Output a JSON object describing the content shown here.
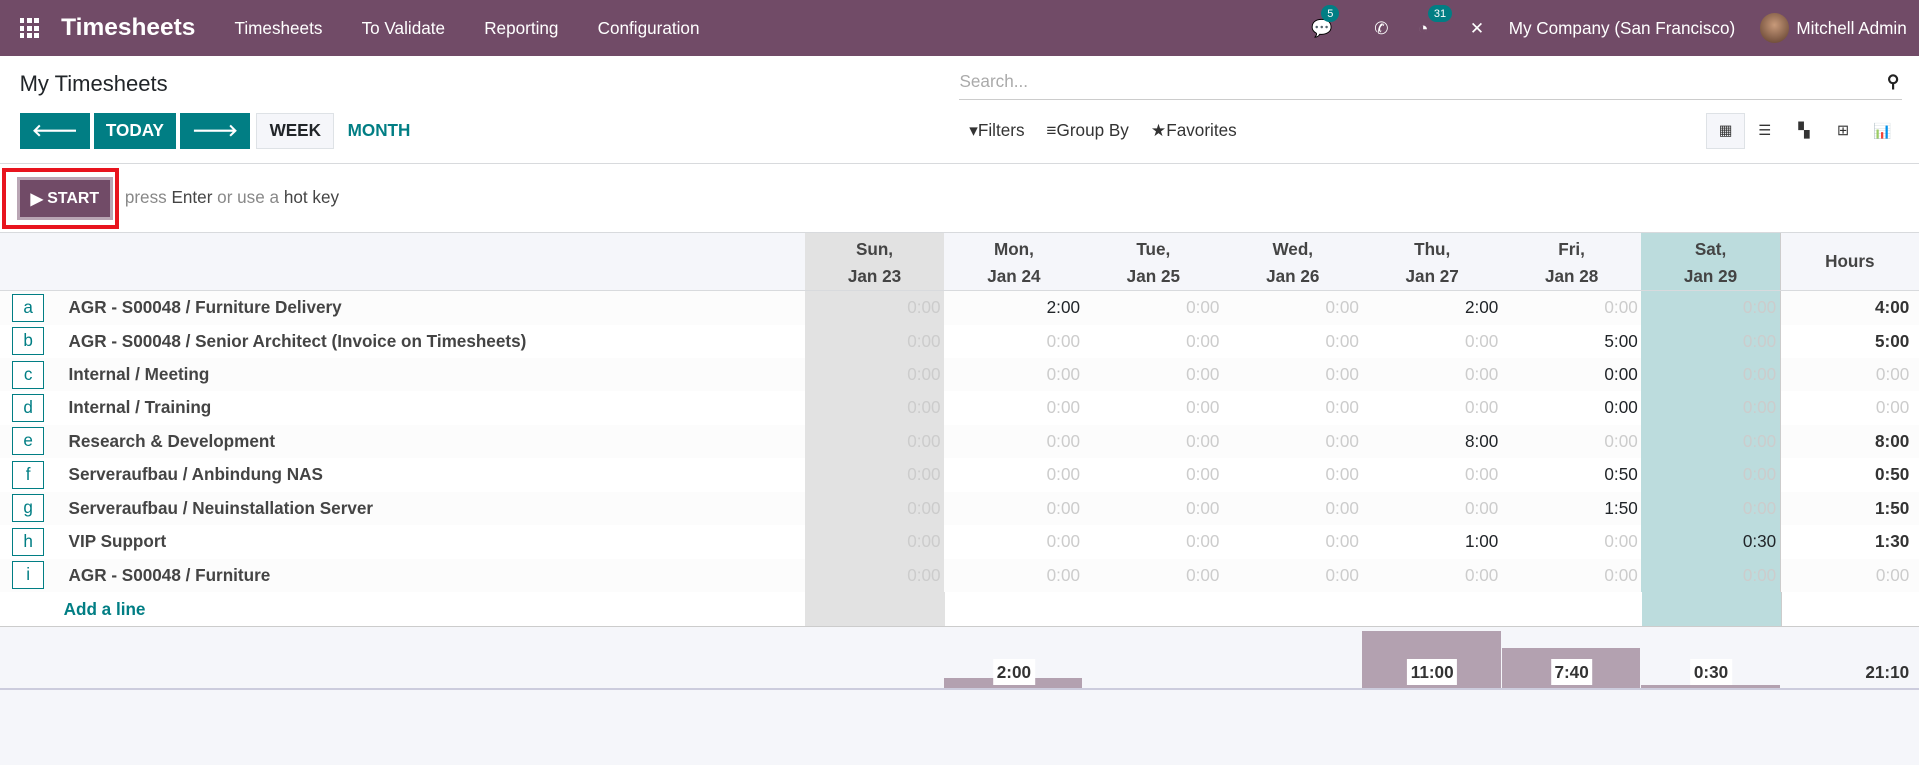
{
  "colors": {
    "brand": "#714B67",
    "accent": "#017e84",
    "highlight": "#e8141e"
  },
  "navbar": {
    "app_title": "Timesheets",
    "menu": [
      "Timesheets",
      "To Validate",
      "Reporting",
      "Configuration"
    ],
    "messages_count": "5",
    "activities_count": "31",
    "company": "My Company (San Francisco)",
    "user": "Mitchell Admin"
  },
  "control": {
    "title": "My Timesheets",
    "today": "TODAY",
    "week": "WEEK",
    "month": "MONTH",
    "search_placeholder": "Search...",
    "filters": "Filters",
    "group_by": "Group By",
    "favorites": "Favorites"
  },
  "start": {
    "label": "START",
    "hint_pre": "press ",
    "hint_key1": "Enter",
    "hint_mid": " or use a ",
    "hint_key2": "hot key"
  },
  "grid": {
    "days": [
      {
        "d": "Sun,",
        "date": "Jan 23"
      },
      {
        "d": "Mon,",
        "date": "Jan 24"
      },
      {
        "d": "Tue,",
        "date": "Jan 25"
      },
      {
        "d": "Wed,",
        "date": "Jan 26"
      },
      {
        "d": "Thu,",
        "date": "Jan 27"
      },
      {
        "d": "Fri,",
        "date": "Jan 28"
      },
      {
        "d": "Sat,",
        "date": "Jan 29"
      }
    ],
    "hours_header": "Hours",
    "rows": [
      {
        "key": "a",
        "label": "AGR - S00048  /  Furniture Delivery",
        "cells": [
          "0:00",
          "2:00",
          "0:00",
          "0:00",
          "2:00",
          "0:00",
          "0:00"
        ],
        "filled": [
          false,
          true,
          false,
          false,
          true,
          false,
          false
        ],
        "total": "4:00"
      },
      {
        "key": "b",
        "label": "AGR - S00048  /  Senior Architect (Invoice on Timesheets)",
        "cells": [
          "0:00",
          "0:00",
          "0:00",
          "0:00",
          "0:00",
          "5:00",
          "0:00"
        ],
        "filled": [
          false,
          false,
          false,
          false,
          false,
          true,
          false
        ],
        "total": "5:00"
      },
      {
        "key": "c",
        "label": "Internal  /  Meeting",
        "cells": [
          "0:00",
          "0:00",
          "0:00",
          "0:00",
          "0:00",
          "0:00",
          "0:00"
        ],
        "filled": [
          false,
          false,
          false,
          false,
          false,
          true,
          false
        ],
        "total": "0:00"
      },
      {
        "key": "d",
        "label": "Internal  /  Training",
        "cells": [
          "0:00",
          "0:00",
          "0:00",
          "0:00",
          "0:00",
          "0:00",
          "0:00"
        ],
        "filled": [
          false,
          false,
          false,
          false,
          false,
          true,
          false
        ],
        "total": "0:00"
      },
      {
        "key": "e",
        "label": "Research & Development",
        "cells": [
          "0:00",
          "0:00",
          "0:00",
          "0:00",
          "8:00",
          "0:00",
          "0:00"
        ],
        "filled": [
          false,
          false,
          false,
          false,
          true,
          false,
          false
        ],
        "total": "8:00"
      },
      {
        "key": "f",
        "label": "Serveraufbau  /  Anbindung NAS",
        "cells": [
          "0:00",
          "0:00",
          "0:00",
          "0:00",
          "0:00",
          "0:50",
          "0:00"
        ],
        "filled": [
          false,
          false,
          false,
          false,
          false,
          true,
          false
        ],
        "total": "0:50"
      },
      {
        "key": "g",
        "label": "Serveraufbau  /  Neuinstallation Server",
        "cells": [
          "0:00",
          "0:00",
          "0:00",
          "0:00",
          "0:00",
          "1:50",
          "0:00"
        ],
        "filled": [
          false,
          false,
          false,
          false,
          false,
          true,
          false
        ],
        "total": "1:50"
      },
      {
        "key": "h",
        "label": "VIP Support",
        "cells": [
          "0:00",
          "0:00",
          "0:00",
          "0:00",
          "1:00",
          "0:00",
          "0:30"
        ],
        "filled": [
          false,
          false,
          false,
          false,
          true,
          false,
          true
        ],
        "total": "1:30"
      },
      {
        "key": "i",
        "label": "AGR - S00048  /  Furniture",
        "cells": [
          "0:00",
          "0:00",
          "0:00",
          "0:00",
          "0:00",
          "0:00",
          "0:00"
        ],
        "filled": [
          false,
          false,
          false,
          false,
          false,
          false,
          false
        ],
        "total": "0:00"
      }
    ],
    "add_line": "Add a line",
    "day_totals": [
      "",
      "2:00",
      "",
      "",
      "11:00",
      "7:40",
      "0:30"
    ],
    "day_total_hours": [
      0,
      2,
      0,
      0,
      11,
      7.667,
      0.5
    ],
    "grand_total": "21:10"
  }
}
